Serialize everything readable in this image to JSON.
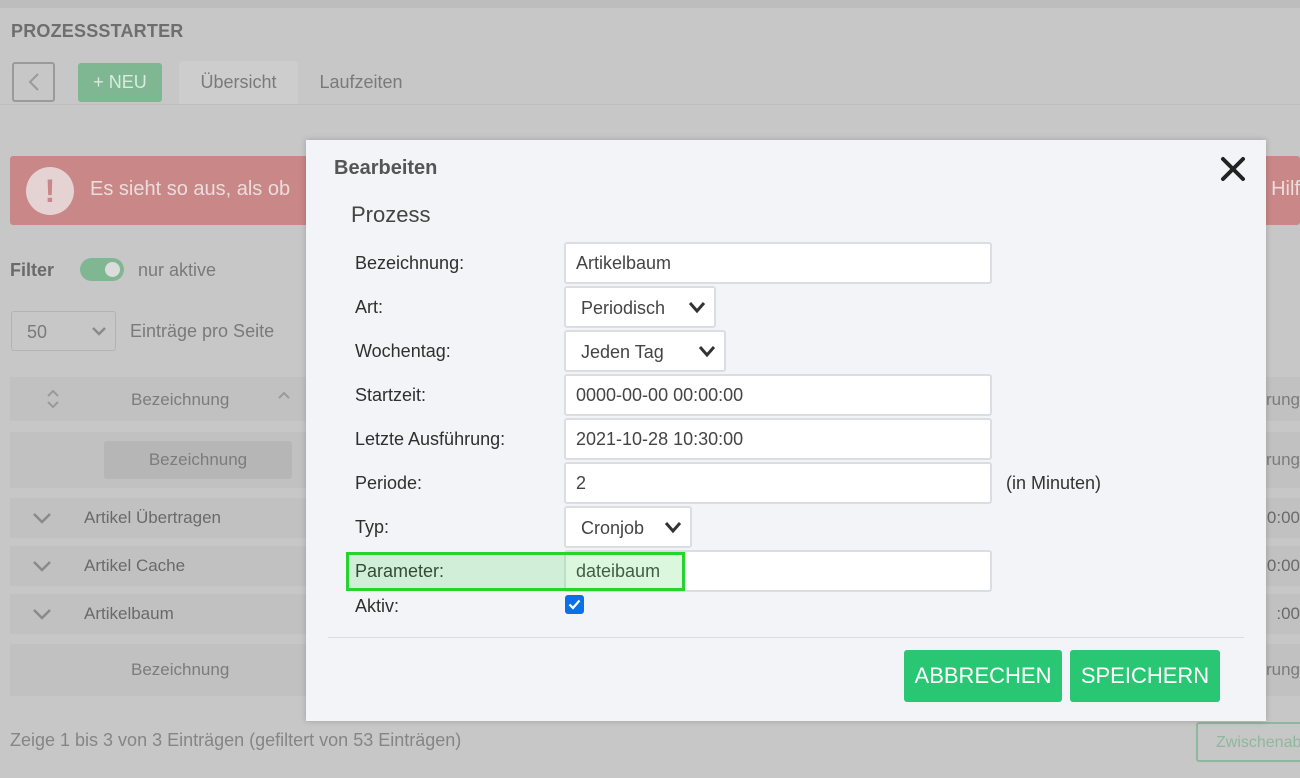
{
  "page": {
    "title": "PROZESSSTARTER",
    "new_button": "+ NEU",
    "tabs": [
      "Übersicht",
      "Laufzeiten"
    ]
  },
  "alert": {
    "text": "Es sieht so aus, als ob",
    "text_right": "Hilf"
  },
  "filter": {
    "label": "Filter",
    "toggle_label": "nur aktive",
    "toggle_on": true
  },
  "pagination": {
    "per_page_value": "50",
    "per_page_label": "Einträge pro Seite"
  },
  "table": {
    "header_column": "Bezeichnung",
    "header_right": "rung",
    "filter_placeholder": "Bezeichnung",
    "filter_right": "hrung",
    "rows": [
      {
        "name": "Artikel Übertragen",
        "right": "0:00"
      },
      {
        "name": "Artikel Cache",
        "right": "0:00"
      },
      {
        "name": "Artikelbaum",
        "right": ":00"
      }
    ],
    "sub_header": "Bezeichnung",
    "sub_header_right": "rung",
    "info": "Zeige 1 bis 3 von 3 Einträgen (gefiltert von 53 Einträgen)",
    "side_button": "Zwischenablage"
  },
  "modal": {
    "title": "Bearbeiten",
    "section": "Prozess",
    "fields": {
      "bezeichnung": {
        "label": "Bezeichnung:",
        "value": "Artikelbaum"
      },
      "art": {
        "label": "Art:",
        "value": "Periodisch"
      },
      "wochentag": {
        "label": "Wochentag:",
        "value": "Jeden Tag"
      },
      "startzeit": {
        "label": "Startzeit:",
        "value": "0000-00-00 00:00:00"
      },
      "letzte": {
        "label": "Letzte Ausführung:",
        "value": "2021-10-28 10:30:00"
      },
      "periode": {
        "label": "Periode:",
        "value": "2",
        "unit": "(in Minuten)"
      },
      "typ": {
        "label": "Typ:",
        "value": "Cronjob"
      },
      "parameter": {
        "label": "Parameter:",
        "value": "dateibaum"
      },
      "aktiv": {
        "label": "Aktiv:",
        "checked": true
      }
    },
    "cancel_label": "ABBRECHEN",
    "save_label": "SPEICHERN"
  },
  "colors": {
    "accent_green": "#29c773",
    "checkbox_blue": "#0a70e8",
    "highlight_green": "#25d52e",
    "overlay_gray": "#c7c7c7"
  },
  "icons": [
    "chevron-left-icon",
    "exclamation-icon",
    "sort-icon",
    "chevron-down-icon",
    "close-icon",
    "check-icon"
  ]
}
